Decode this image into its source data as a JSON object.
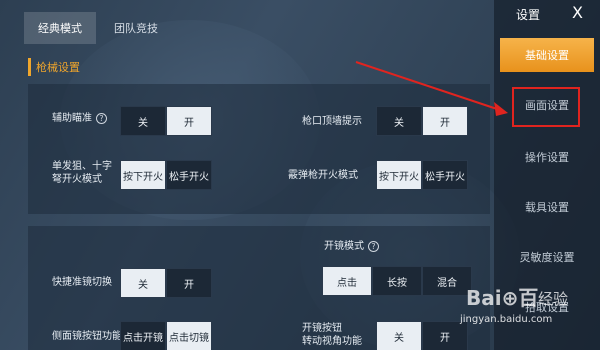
{
  "tabs": [
    {
      "label": "经典模式",
      "active": true
    },
    {
      "label": "团队竞技",
      "active": false
    }
  ],
  "section_title": "枪械设置",
  "settings": {
    "aim_assist": {
      "label": "辅助瞄准",
      "help": "?",
      "options": [
        "关",
        "开"
      ],
      "selected": "开"
    },
    "muzzle_hint": {
      "label": "枪口顶墙提示",
      "options": [
        "关",
        "开"
      ],
      "selected": "开"
    },
    "sniper_fire": {
      "label_line1": "单发狙、十字",
      "label_line2": "弩开火模式",
      "options": [
        "按下开火",
        "松手开火"
      ],
      "selected": "按下开火"
    },
    "shotgun_fire": {
      "label": "霰弹枪开火模式",
      "options": [
        "按下开火",
        "松手开火"
      ],
      "selected": "按下开火"
    },
    "scope_mode": {
      "label": "开镜模式",
      "help": "?",
      "options": [
        "点击",
        "长按",
        "混合"
      ],
      "selected": "点击"
    },
    "quick_scope": {
      "label": "快捷准镜切换",
      "options": [
        "关",
        "开"
      ],
      "selected": "关"
    },
    "side_scope": {
      "label": "侧面镜按钮功能",
      "options": [
        "点击开镜",
        "点击切镜"
      ],
      "selected": "点击切镜"
    },
    "scope_rotate": {
      "label_line1": "开镜按钮",
      "label_line2": "转动视角功能",
      "options": [
        "关",
        "开"
      ],
      "selected": "关"
    }
  },
  "sidebar": {
    "title": "设置",
    "close": "X",
    "items": [
      {
        "label": "基础设置",
        "active": true
      },
      {
        "label": "画面设置",
        "active": false
      },
      {
        "label": "操作设置",
        "active": false
      },
      {
        "label": "载具设置",
        "active": false
      },
      {
        "label": "灵敏度设置",
        "active": false
      },
      {
        "label": "拾取设置",
        "active": false
      }
    ]
  },
  "watermark": {
    "logo": "Bai⊕百",
    "text": "经验",
    "url": "jingyan.baidu.com"
  },
  "colors": {
    "accent": "#f0a62c",
    "highlight": "#e0241f",
    "selected_option": "#e9eef3"
  }
}
